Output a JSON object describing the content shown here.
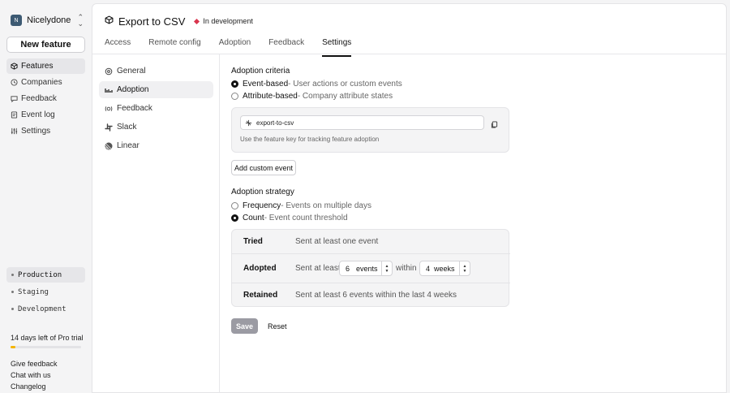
{
  "sidebar": {
    "org_initial": "N",
    "org_name": "Nicelydone",
    "new_feature": "New feature",
    "nav": [
      {
        "label": "Features",
        "icon": "cube-icon",
        "active": true
      },
      {
        "label": "Companies",
        "icon": "companies-icon"
      },
      {
        "label": "Feedback",
        "icon": "feedback-icon"
      },
      {
        "label": "Event log",
        "icon": "event-log-icon"
      },
      {
        "label": "Settings",
        "icon": "settings-icon"
      }
    ],
    "environments": [
      "Production",
      "Staging",
      "Development"
    ],
    "trial": {
      "text": "14 days left of Pro trial",
      "progress": 0.07
    },
    "footer_links": [
      "Give feedback",
      "Chat with us",
      "Changelog"
    ]
  },
  "header": {
    "title": "Export to CSV",
    "status": "In development",
    "status_color": "#d9364e"
  },
  "tabs": [
    "Access",
    "Remote config",
    "Adoption",
    "Feedback",
    "Settings"
  ],
  "settings_nav": [
    {
      "label": "General",
      "icon": "gear-icon"
    },
    {
      "label": "Adoption",
      "icon": "adoption-icon",
      "active": true
    },
    {
      "label": "Feedback",
      "icon": "feedback-icon"
    },
    {
      "label": "Slack",
      "icon": "slack-icon"
    },
    {
      "label": "Linear",
      "icon": "linear-icon"
    }
  ],
  "adoption_criteria": {
    "heading": "Adoption criteria",
    "options": [
      {
        "label": "Event-based",
        "desc": " - User actions or custom events",
        "selected": true
      },
      {
        "label": "Attribute-based",
        "desc": " - Company attribute states",
        "selected": false
      }
    ],
    "feature_key": "export-to-csv",
    "help": "Use the feature key for tracking feature adoption",
    "add_event": "Add custom event"
  },
  "adoption_strategy": {
    "heading": "Adoption strategy",
    "options": [
      {
        "label": "Frequency",
        "desc": " - Events on multiple days",
        "selected": false
      },
      {
        "label": "Count",
        "desc": " - Event count threshold",
        "selected": true
      }
    ],
    "rows": {
      "tried": {
        "label": "Tried",
        "text": "Sent at least one event"
      },
      "adopted": {
        "label": "Adopted",
        "prefix": "Sent at least",
        "events_value": "6",
        "events_unit": "events",
        "within": "within",
        "weeks_value": "4",
        "weeks_unit": "weeks"
      },
      "retained": {
        "label": "Retained",
        "text": "Sent at least 6 events within the last 4 weeks"
      }
    }
  },
  "actions": {
    "save": "Save",
    "reset": "Reset"
  }
}
